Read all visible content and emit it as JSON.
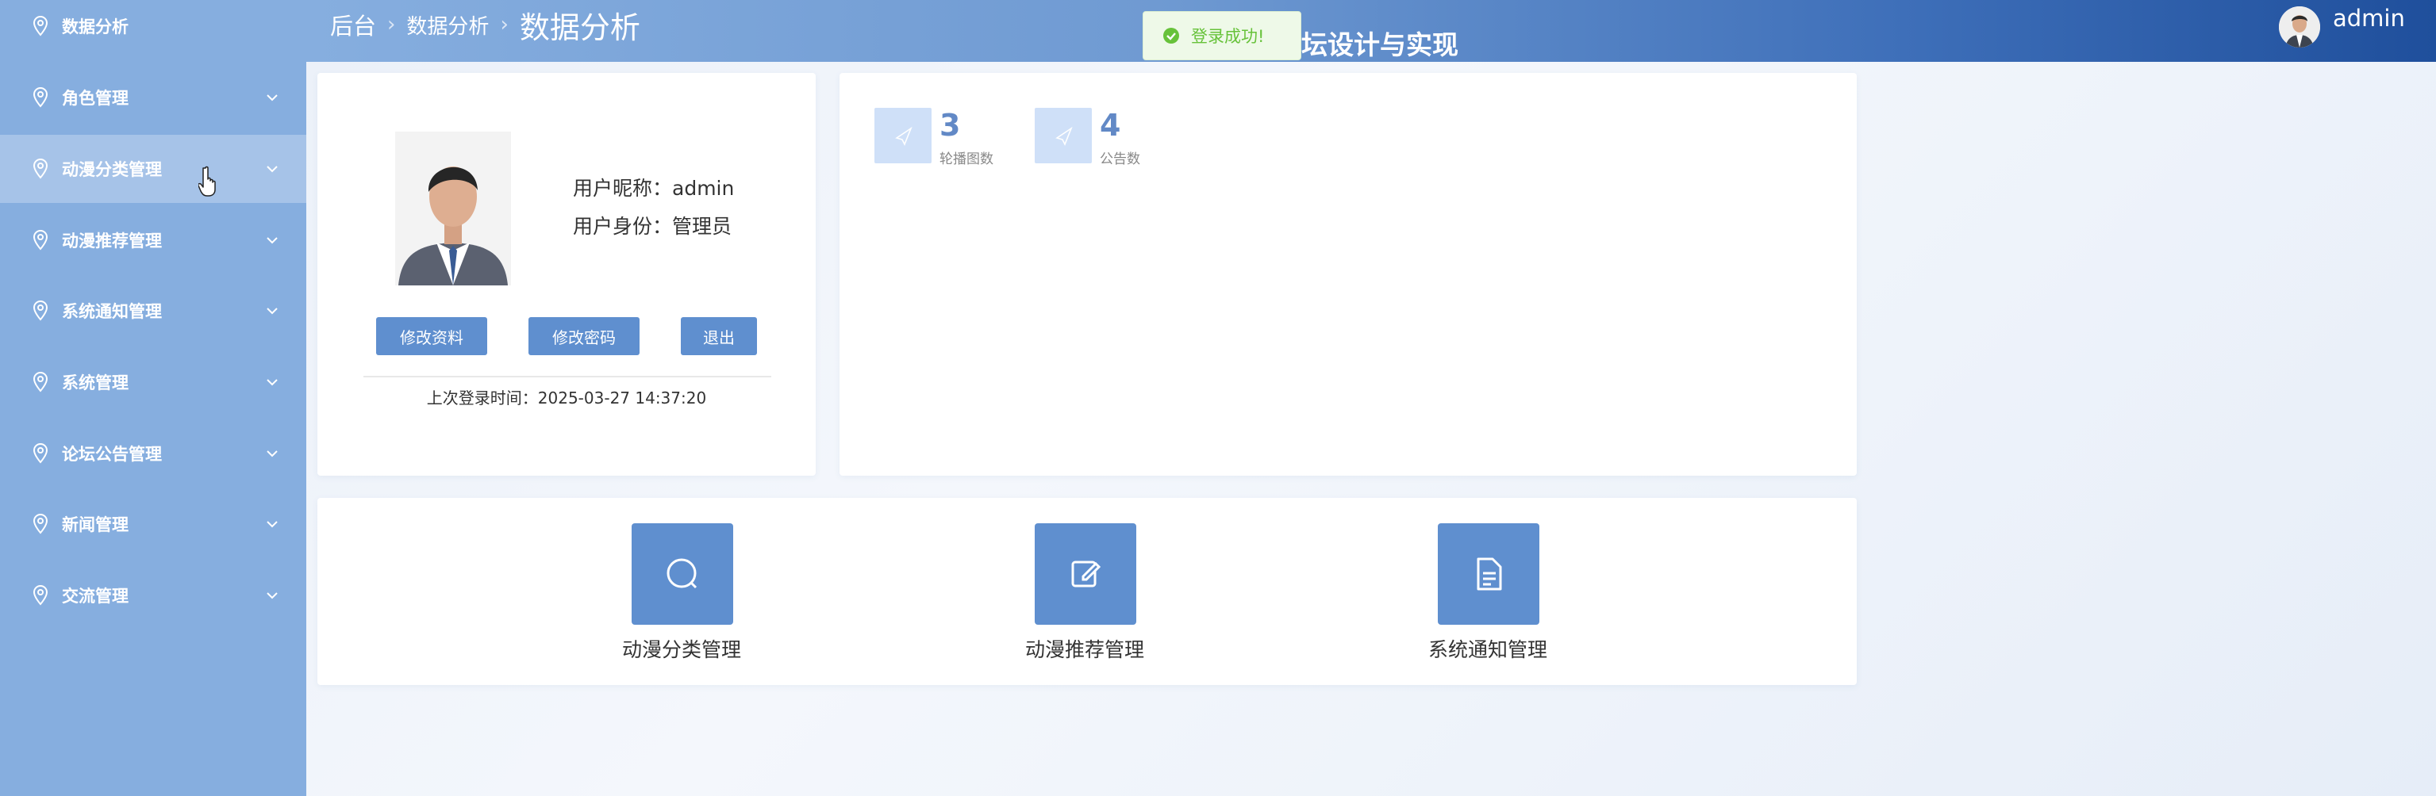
{
  "sidebar": {
    "items": [
      {
        "label": "数据分析",
        "icon": "pin-icon",
        "chevron": false,
        "active": false
      },
      {
        "label": "角色管理",
        "icon": "pin-icon",
        "chevron": true,
        "active": false
      },
      {
        "label": "动漫分类管理",
        "icon": "pin-icon",
        "chevron": true,
        "active": true
      },
      {
        "label": "动漫推荐管理",
        "icon": "pin-icon",
        "chevron": true,
        "active": false
      },
      {
        "label": "系统通知管理",
        "icon": "pin-icon",
        "chevron": true,
        "active": false
      },
      {
        "label": "系统管理",
        "icon": "pin-icon",
        "chevron": true,
        "active": false
      },
      {
        "label": "论坛公告管理",
        "icon": "pin-icon",
        "chevron": true,
        "active": false
      },
      {
        "label": "新闻管理",
        "icon": "pin-icon",
        "chevron": true,
        "active": false
      },
      {
        "label": "交流管理",
        "icon": "pin-icon",
        "chevron": true,
        "active": false
      }
    ]
  },
  "header": {
    "breadcrumb": [
      "后台",
      "数据分析",
      "数据分析"
    ],
    "title_fragment": "坛设计与实现",
    "toast": "登录成功!",
    "username": "admin"
  },
  "user_card": {
    "nickname_label": "用户昵称：",
    "nickname": "admin",
    "role_label": "用户身份：",
    "role": "管理员",
    "buttons": [
      "修改资料",
      "修改密码",
      "退出"
    ],
    "last_login_label": "上次登录时间：",
    "last_login": "2025-03-27 14:37:20"
  },
  "stats": [
    {
      "value": "3",
      "label": "轮播图数",
      "icon": "send-icon"
    },
    {
      "value": "4",
      "label": "公告数",
      "icon": "send-icon"
    }
  ],
  "shortcuts": [
    {
      "label": "动漫分类管理",
      "icon": "search-icon"
    },
    {
      "label": "动漫推荐管理",
      "icon": "edit-icon"
    },
    {
      "label": "系统通知管理",
      "icon": "document-icon"
    }
  ],
  "colors": {
    "sidebar": "#86aedf",
    "sidebar_active": "#a6c3e8",
    "primary": "#5f8fcf",
    "stat_icon_bg": "#cfe0f8",
    "stat_number": "#6289c6",
    "toast_text": "#67c23a"
  }
}
